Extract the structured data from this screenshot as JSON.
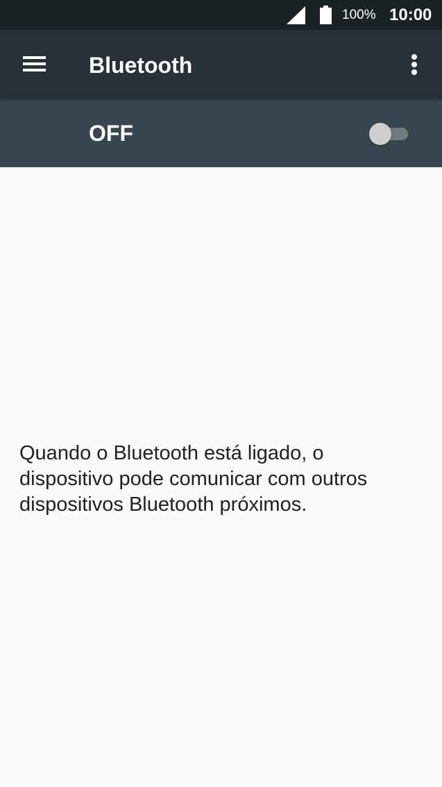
{
  "status_bar": {
    "battery_percent": "100%",
    "time": "10:00",
    "icons": [
      "cell-signal-icon",
      "battery-icon"
    ]
  },
  "app_bar": {
    "title": "Bluetooth",
    "icons": [
      "hamburger-menu-icon",
      "more-vert-icon"
    ]
  },
  "bluetooth_switch": {
    "state_label": "OFF",
    "enabled": false
  },
  "content": {
    "description": "Quando o Bluetooth está ligado, o dispositivo pode comunicar com outros dispositivos Bluetooth próximos."
  },
  "colors": {
    "status_bar": "#1a2226",
    "app_bar": "#263238",
    "switch_bar": "#37474f",
    "background": "#fafafa",
    "text_primary": "#212121",
    "toggle_track_off": "#6d7b82",
    "toggle_thumb_off": "#cfcfcf"
  }
}
